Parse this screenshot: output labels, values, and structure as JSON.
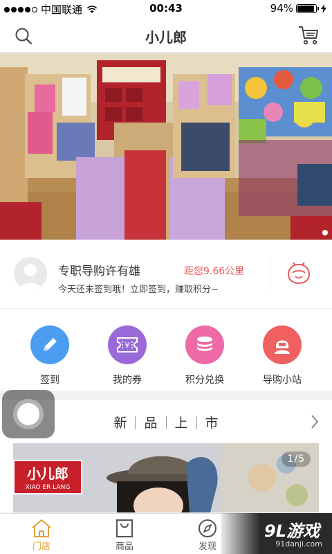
{
  "status_bar": {
    "carrier": "中国联通",
    "time": "00:43",
    "battery_text": "94%",
    "battery_level": 0.94
  },
  "nav": {
    "title": "小儿郎",
    "search_icon": "search-icon",
    "cart_icon": "cart-icon"
  },
  "banner": {
    "page_indicator_count": 1
  },
  "guide": {
    "name": "专职导购许有雄",
    "distance": "距您9.66公里",
    "tip": "今天还未签到哦！立即签到，赚取积分~",
    "chat_icon": "chat-icon"
  },
  "quick_actions": [
    {
      "label": "签到",
      "icon": "pencil-icon",
      "color": "#4a9df0"
    },
    {
      "label": "我的券",
      "icon": "coupon-icon",
      "color": "#9a6ad8"
    },
    {
      "label": "积分兑换",
      "icon": "coins-icon",
      "color": "#ee6aa6"
    },
    {
      "label": "导购小站",
      "icon": "guide-avatar-icon",
      "color": "#f06060"
    }
  ],
  "new_arrivals": {
    "title_chars": [
      "新",
      "品",
      "上",
      "市"
    ],
    "counter": "1/5",
    "brand_logo": "小儿郎",
    "brand_sub": "XIAO ER LANG"
  },
  "tab_bar": {
    "tabs": [
      {
        "label": "门店",
        "icon": "store-icon",
        "active": true
      },
      {
        "label": "商品",
        "icon": "bag-icon",
        "active": false
      },
      {
        "label": "发现",
        "icon": "compass-icon",
        "active": false
      }
    ],
    "active_color": "#e0a13a"
  },
  "watermark": {
    "brand": "9L游戏",
    "url": "91danji.com"
  }
}
